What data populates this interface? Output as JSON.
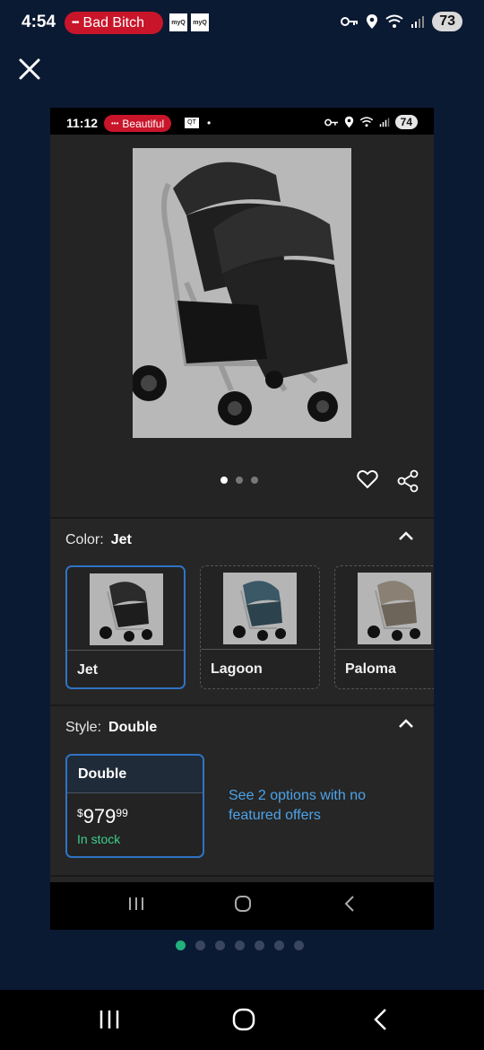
{
  "outer_status": {
    "time": "4:54",
    "pill_text": "Bad Bitch",
    "myq_label": "myQ",
    "battery": "73"
  },
  "inner_status": {
    "time": "11:12",
    "pill_text": "Beautiful",
    "box_label": "QT",
    "battery": "74"
  },
  "gallery": {
    "dot_count": 3,
    "active_index": 0
  },
  "color_section": {
    "label": "Color:",
    "value": "Jet",
    "options": [
      {
        "name": "Jet",
        "selected": true,
        "canopy_color": "#2b2b2b"
      },
      {
        "name": "Lagoon",
        "selected": false,
        "canopy_color": "#3b5866"
      },
      {
        "name": "Paloma",
        "selected": false,
        "canopy_color": "#8a8074"
      }
    ]
  },
  "style_section": {
    "label": "Style:",
    "value": "Double",
    "card": {
      "title": "Double",
      "currency": "$",
      "price_whole": "979",
      "price_cents": "99",
      "stock": "In stock"
    },
    "see_options": "See 2 options with no featured offers"
  },
  "pager": {
    "count": 7,
    "active_index": 0
  },
  "colors": {
    "accent_blue": "#2f73c4",
    "link_blue": "#4da3e8",
    "stock_green": "#3fcf8e",
    "pill_red": "#c9152a"
  }
}
